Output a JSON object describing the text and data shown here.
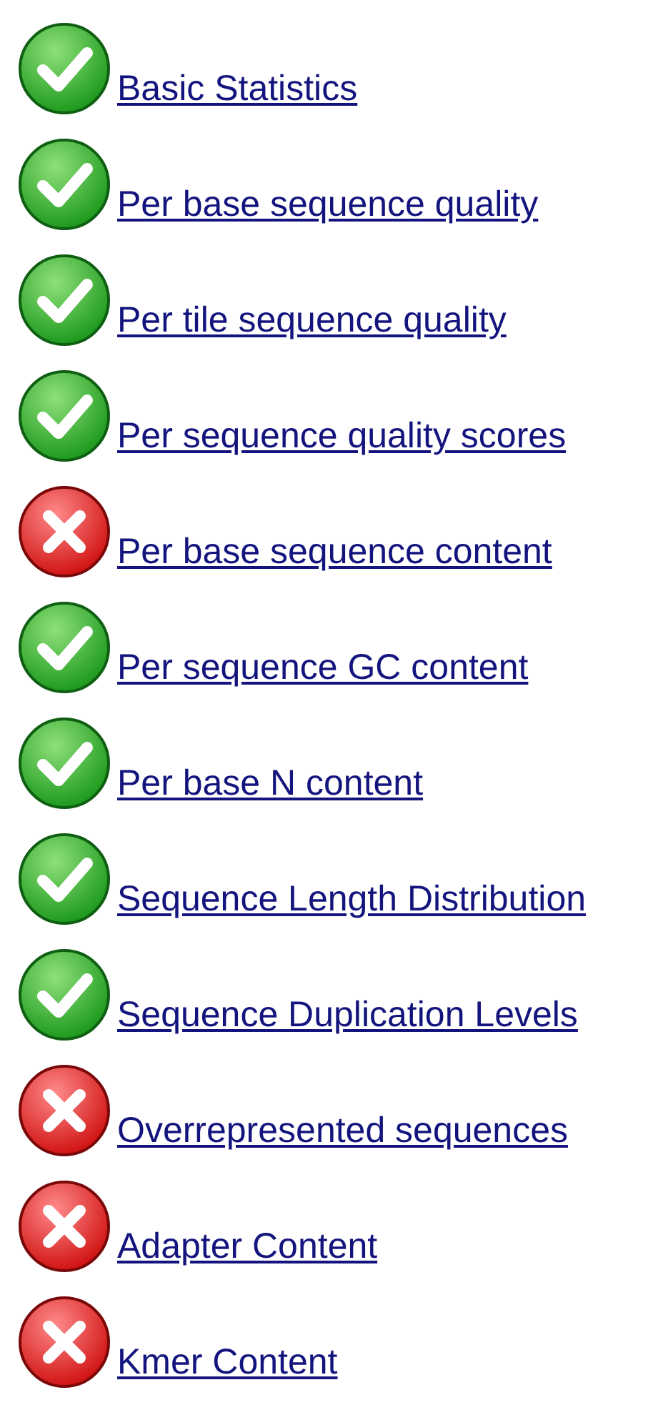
{
  "modules": [
    {
      "label": "Basic Statistics",
      "passed": true
    },
    {
      "label": "Per base sequence quality",
      "passed": true
    },
    {
      "label": "Per tile sequence quality",
      "passed": true
    },
    {
      "label": "Per sequence quality scores",
      "passed": true
    },
    {
      "label": "Per base sequence content",
      "passed": false
    },
    {
      "label": "Per sequence GC content",
      "passed": true
    },
    {
      "label": "Per base N content",
      "passed": true
    },
    {
      "label": "Sequence Length Distribution",
      "passed": true
    },
    {
      "label": "Sequence Duplication Levels",
      "passed": true
    },
    {
      "label": "Overrepresented sequences",
      "passed": false
    },
    {
      "label": "Adapter Content",
      "passed": false
    },
    {
      "label": "Kmer Content",
      "passed": false
    }
  ]
}
